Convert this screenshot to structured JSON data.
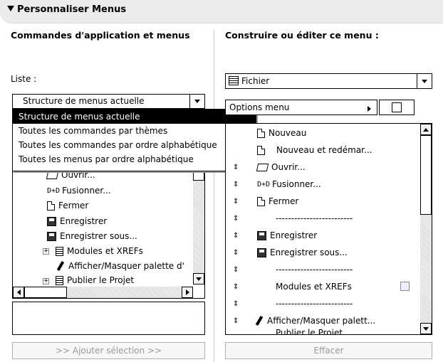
{
  "header": {
    "title": "Personnaliser Menus"
  },
  "left": {
    "heading": "Commandes d'application et menus",
    "list_label": "Liste :",
    "list_selected": "Structure de menus actuelle",
    "dropdown_options": [
      "Structure de menus actuelle",
      "Toutes les commandes par thèmes",
      "Toutes les commandes par ordre alphabétique",
      "Toutes les menus par ordre alphabétique"
    ],
    "tree_items": [
      {
        "label": "Ouvrir...",
        "icon": "folder-open-icon"
      },
      {
        "label": "Fusionner...",
        "icon": "merge-icon"
      },
      {
        "label": "Fermer",
        "icon": "close-doc-icon"
      },
      {
        "label": "Enregistrer",
        "icon": "save-icon"
      },
      {
        "label": "Enregistrer sous...",
        "icon": "save-as-icon"
      },
      {
        "label": "Modules et XREFs",
        "icon": "list-doc-icon"
      },
      {
        "label": "Afficher/Masquer palette d'",
        "icon": "pen-icon"
      },
      {
        "label": "Publier le Projet",
        "icon": "list-doc-icon"
      }
    ],
    "add_button": ">> Ajouter sélection >>"
  },
  "right": {
    "heading": "Construire ou éditer ce menu :",
    "menu_selected": "Fichier",
    "options_label": "Options menu",
    "items": [
      {
        "label": "Nouveau",
        "icon": "new-doc-icon"
      },
      {
        "label": "Nouveau et redémar...",
        "icon": "new-restart-icon"
      },
      {
        "label": "Ouvrir...",
        "icon": "folder-open-icon"
      },
      {
        "label": "Fusionner...",
        "icon": "merge-icon"
      },
      {
        "label": "Fermer",
        "icon": "close-doc-icon"
      },
      {
        "label": "-------------------------",
        "icon": ""
      },
      {
        "label": "Enregistrer",
        "icon": "save-icon"
      },
      {
        "label": "Enregistrer sous...",
        "icon": "save-as-icon"
      },
      {
        "label": "-------------------------",
        "icon": ""
      },
      {
        "label": "Modules et XREFs",
        "icon": ""
      },
      {
        "label": "-------------------------",
        "icon": ""
      },
      {
        "label": "Afficher/Masquer palett...",
        "icon": "pen-icon"
      },
      {
        "label": "Publier le Projet",
        "icon": ""
      }
    ],
    "clear_button": "Effacer"
  }
}
